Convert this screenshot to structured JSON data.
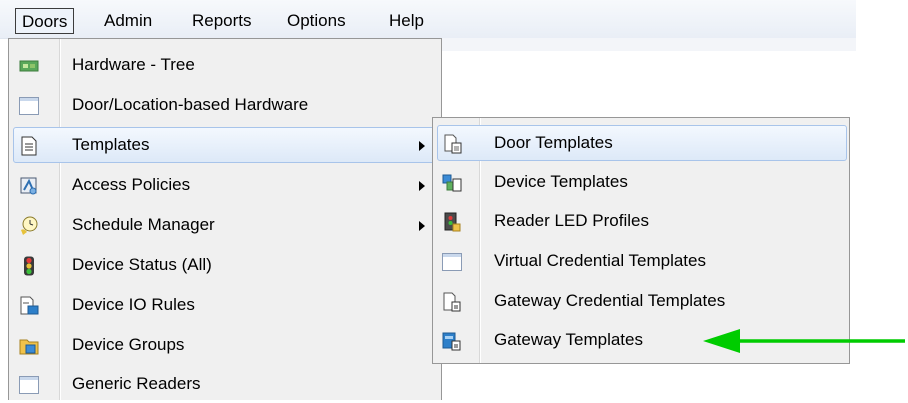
{
  "menubar": {
    "items": [
      "Doors",
      "Admin",
      "Reports",
      "Options",
      "Help"
    ],
    "active": "Doors"
  },
  "doors_menu": {
    "items": [
      {
        "label": "Hardware - Tree",
        "icon": "hardware-tree-icon",
        "submenu": false
      },
      {
        "label": "Door/Location-based Hardware",
        "icon": "window-icon",
        "submenu": false
      },
      {
        "label": "Templates",
        "icon": "templates-icon",
        "submenu": true,
        "highlighted": true
      },
      {
        "label": "Access Policies",
        "icon": "access-policies-icon",
        "submenu": true
      },
      {
        "label": "Schedule Manager",
        "icon": "clock-icon",
        "submenu": true
      },
      {
        "label": "Device Status (All)",
        "icon": "traffic-light-icon",
        "submenu": false
      },
      {
        "label": "Device IO Rules",
        "icon": "io-rules-icon",
        "submenu": false
      },
      {
        "label": "Device Groups",
        "icon": "device-groups-icon",
        "submenu": false
      },
      {
        "label": "Generic Readers",
        "icon": "window-icon",
        "submenu": false
      }
    ]
  },
  "templates_submenu": {
    "items": [
      {
        "label": "Door Templates",
        "icon": "door-template-icon",
        "highlighted": true
      },
      {
        "label": "Device Templates",
        "icon": "device-template-icon"
      },
      {
        "label": "Reader LED Profiles",
        "icon": "led-profile-icon"
      },
      {
        "label": "Virtual Credential Templates",
        "icon": "window-icon"
      },
      {
        "label": "Gateway Credential Templates",
        "icon": "document-icon"
      },
      {
        "label": "Gateway Templates",
        "icon": "gateway-template-icon"
      }
    ]
  },
  "annotation": {
    "arrow_color": "#00cc00"
  }
}
